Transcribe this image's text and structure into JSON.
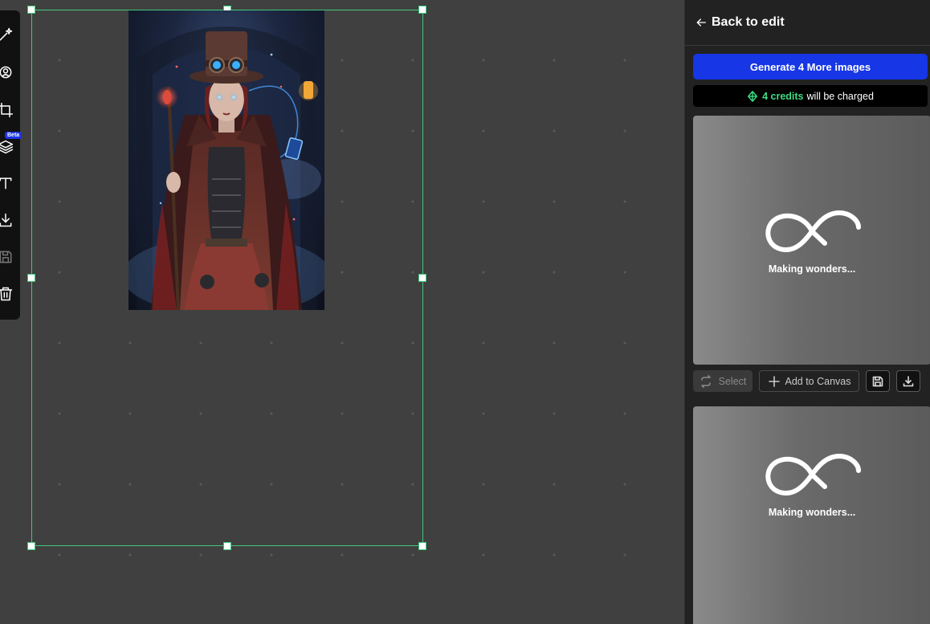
{
  "toolbar": {
    "tools": [
      {
        "name": "magic-wand-icon"
      },
      {
        "name": "face-swap-icon"
      },
      {
        "name": "crop-icon"
      },
      {
        "name": "layers-icon",
        "badge": "Beta"
      },
      {
        "name": "text-icon"
      },
      {
        "name": "download-icon"
      },
      {
        "name": "save-icon",
        "disabled": true
      },
      {
        "name": "trash-icon"
      }
    ]
  },
  "panel": {
    "back_label": "Back to edit",
    "generate_label": "Generate 4 More images",
    "credits_amount": "4 credits",
    "credits_suffix": "will be charged",
    "cards": [
      {
        "status": "Making wonders..."
      },
      {
        "status": "Making wonders..."
      }
    ],
    "actions": {
      "select_label": "Select",
      "add_label": "Add to Canvas"
    }
  },
  "colors": {
    "accent_blue": "#1736e6",
    "selection_green": "#3ec97a",
    "credit_green": "#3ddc84"
  }
}
